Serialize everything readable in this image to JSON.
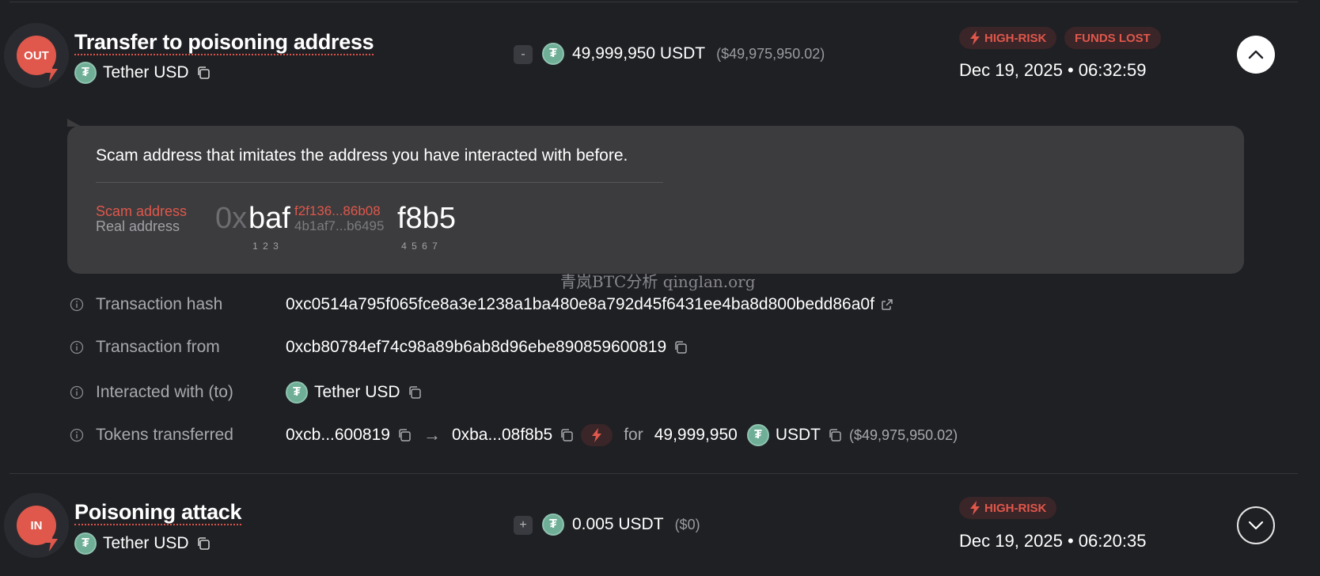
{
  "tx1": {
    "direction": "OUT",
    "title": "Transfer to poisoning address",
    "token_name": "Tether USD",
    "sign": "-",
    "amount": "49,999,950 USDT",
    "amount_usd": "($49,975,950.02)",
    "badges": [
      "HIGH-RISK",
      "FUNDS LOST"
    ],
    "date": "Dec 19, 2025 • 06:32:59",
    "expanded": true
  },
  "callout": {
    "description": "Scam address that imitates the address you have interacted with before.",
    "scam_label": "Scam address",
    "real_label": "Real address",
    "prefix": "0x",
    "match_start": "baf",
    "scam_middle": "f2f136...86b08",
    "real_middle": "4b1af7...b6495",
    "match_end": "f8b5",
    "digits_start": [
      "1",
      "2",
      "3"
    ],
    "digits_end": [
      "4",
      "5",
      "6",
      "7"
    ]
  },
  "watermark": "青岚BTC分析 qinglan.org",
  "details": {
    "hash_label": "Transaction hash",
    "hash_value": "0xc0514a795f065fce8a3e1238a1ba480e8a792d45f6431ee4ba8d800bedd86a0f",
    "from_label": "Transaction from",
    "from_value": "0xcb80784ef74c98a89b6ab8d96ebe890859600819",
    "to_label": "Interacted with (to)",
    "to_value": "Tether USD",
    "tokens_label": "Tokens transferred",
    "tokens_from": "0xcb...600819",
    "tokens_to": "0xba...08f8b5",
    "tokens_for": "for",
    "tokens_amount": "49,999,950",
    "tokens_symbol": "USDT",
    "tokens_usd": "($49,975,950.02)"
  },
  "tx2": {
    "direction": "IN",
    "title": "Poisoning attack",
    "token_name": "Tether USD",
    "sign": "+",
    "amount": "0.005 USDT",
    "amount_usd": "($0)",
    "badges": [
      "HIGH-RISK"
    ],
    "date": "Dec 19, 2025 • 06:20:35",
    "expanded": false
  },
  "colors": {
    "background": "#1f2024",
    "risk_red": "#e0574b",
    "tether_green": "#6fae97",
    "panel": "#3c3c3e"
  },
  "icons": [
    "bolt-icon",
    "copy-icon",
    "info-icon",
    "external-link-icon",
    "chevron-up-icon",
    "chevron-down-icon",
    "tether-icon",
    "arrow-right-icon"
  ]
}
